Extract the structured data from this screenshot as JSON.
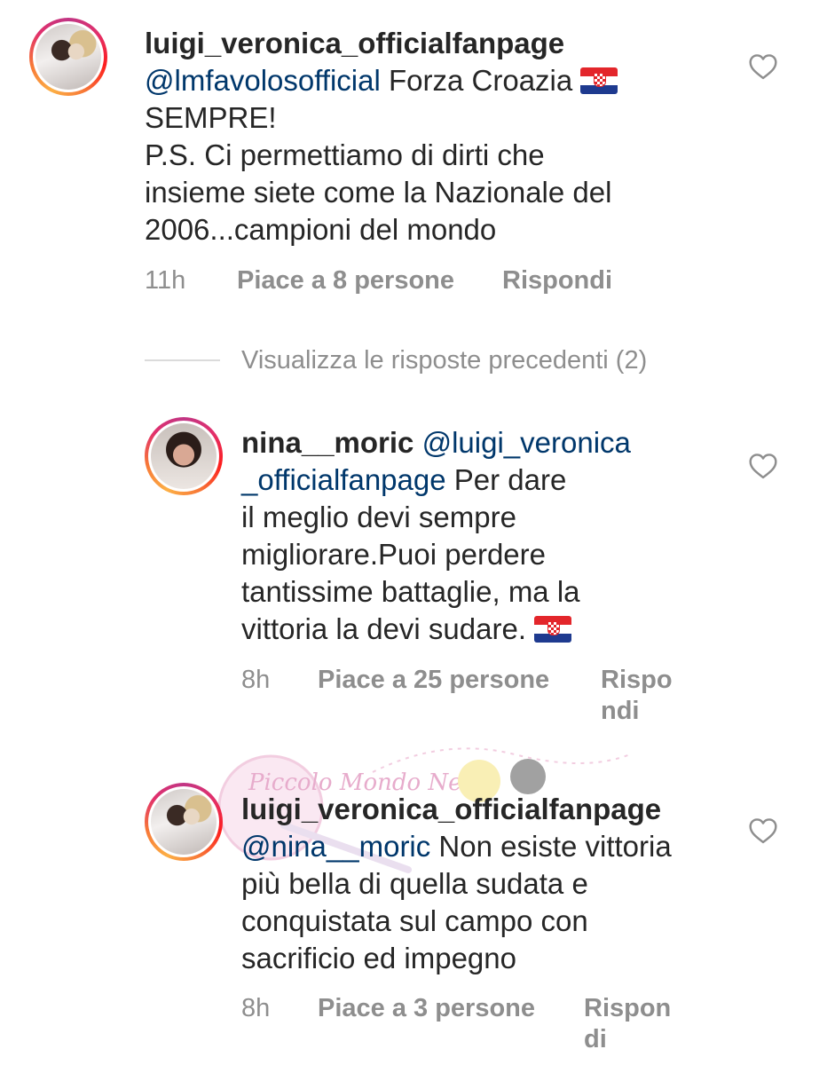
{
  "comments": [
    {
      "username": "luigi_veronica_officialfanpage",
      "mention": "@lmfavolosofficial",
      "line1_text": " Forza Croazia ",
      "lines": [
        "SEMPRE!",
        "P.S. Ci permettiamo di dirti che",
        "insieme siete come la Nazionale del",
        "2006...campioni del mondo"
      ],
      "time": "11h",
      "likes": "Piace a 8 persone",
      "reply": "Rispondi",
      "avatar": "couple-photo"
    },
    {
      "username": "nina__moric",
      "mention_part1": "@luigi_veronica",
      "mention_part2": "_officialfanpage",
      "line2_text": " Per dare",
      "lines": [
        "il meglio devi sempre",
        "migliorare.Puoi perdere",
        "tantissime battaglie, ma la"
      ],
      "last_line": "vittoria la devi sudare. ",
      "time": "8h",
      "likes": "Piace a 25 persone",
      "reply_line1": "Rispo",
      "reply_line2": "ndi",
      "avatar": "nina-photo"
    },
    {
      "username": "luigi_veronica_officialfanpage",
      "mention": "@nina__moric",
      "line1_text": " Non esiste vittoria",
      "lines": [
        "più bella di quella sudata e",
        "conquistata sul campo con",
        "sacrificio ed impegno"
      ],
      "time": "8h",
      "likes": "Piace a 3 persone",
      "reply_line1": "Rispon",
      "reply_line2": "di",
      "avatar": "couple-photo"
    }
  ],
  "view_previous": "Visualizza le risposte precedenti (2)",
  "watermark": {
    "text": "Piccolo Mondo News"
  },
  "icons": {
    "like": "heart-outline-icon",
    "flag": "croatia-flag-icon"
  },
  "colors": {
    "mention": "#00376b",
    "meta": "#8e8e8e",
    "divider": "#dbdbdb"
  }
}
